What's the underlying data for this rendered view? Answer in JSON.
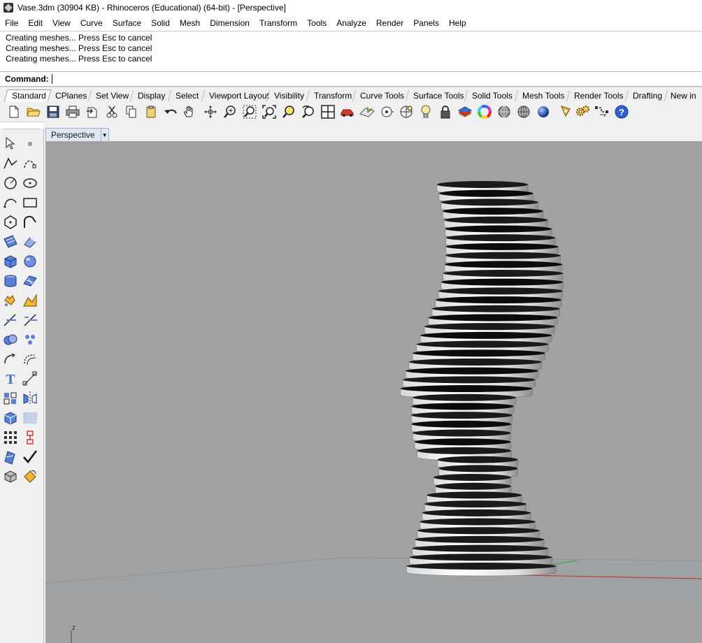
{
  "window": {
    "title": "Vase.3dm (30904 KB) - Rhinoceros (Educational) (64-bit) - [Perspective]"
  },
  "menu": [
    "File",
    "Edit",
    "View",
    "Curve",
    "Surface",
    "Solid",
    "Mesh",
    "Dimension",
    "Transform",
    "Tools",
    "Analyze",
    "Render",
    "Panels",
    "Help"
  ],
  "history": [
    "Creating meshes... Press Esc to cancel",
    "Creating meshes... Press Esc to cancel",
    "Creating meshes... Press Esc to cancel"
  ],
  "command": {
    "prompt": "Command:",
    "value": ""
  },
  "toolbar_tabs": [
    "Standard",
    "CPlanes",
    "Set View",
    "Display",
    "Select",
    "Viewport Layout",
    "Visibility",
    "Transform",
    "Curve Tools",
    "Surface Tools",
    "Solid Tools",
    "Mesh Tools",
    "Render Tools",
    "Drafting",
    "New in V"
  ],
  "active_tab": "Standard",
  "standard_icons": [
    "new-file-icon",
    "open-folder-icon",
    "save-icon",
    "print-icon",
    "import-icon",
    "cut-icon",
    "copy-icon",
    "paste-icon",
    "undo-icon",
    "pan-hand-icon",
    "rotate-view-icon",
    "zoom-icon",
    "zoom-window-icon",
    "zoom-extents-icon",
    "zoom-selected-icon",
    "undo-view-icon",
    "four-viewports-icon",
    "car-named-views-icon",
    "cplane-icon",
    "object-snap-icon",
    "light-bulb-icon",
    "lock-icon",
    "layer-icon",
    "color-wheel-icon",
    "render-sphere-icon",
    "rendered-sphere-icon",
    "shaded-sphere-icon",
    "rendering-lamp-icon",
    "options-gear-icon",
    "grasshopper-icon",
    "help-icon"
  ],
  "left_icons": [
    [
      "select-arrow-icon",
      "point-icon"
    ],
    [
      "polyline-icon",
      "curve-icon"
    ],
    [
      "circle-icon",
      "ellipse-icon"
    ],
    [
      "arc-icon",
      "rectangle-icon"
    ],
    [
      "polygon-icon",
      "freeform-curve-icon"
    ],
    [
      "surface-corner-icon",
      "extrude-surface-icon"
    ],
    [
      "box-solid-icon",
      "sphere-solid-icon"
    ],
    [
      "cylinder-icon",
      "mesh-plane-icon"
    ],
    [
      "explode-icon",
      "boolean-split-icon"
    ],
    [
      "trim-icon",
      "split-icon"
    ],
    [
      "boolean-union-icon",
      "array-points-icon"
    ],
    [
      "fillet-curve-icon",
      "offset-curve-icon"
    ],
    [
      "text-icon",
      "dimension-icon"
    ],
    [
      "group-icon",
      "mirror-icon"
    ],
    [
      "block-icon",
      "dimension-linear-icon"
    ],
    [
      "array-grid-icon",
      "history-icon"
    ],
    [
      "analyze-icon",
      "check-icon"
    ],
    [
      "render-material-icon",
      "flow-icon"
    ]
  ],
  "viewport": {
    "label": "Perspective",
    "axis_label": "z"
  },
  "colors": {
    "viewport_bg": "#a2a2a2",
    "ground": "#9ea1a3",
    "x_axis": "#cc2a2a",
    "y_axis": "#2fa82f"
  },
  "model": {
    "description_note": "",
    "slice_count": 44
  }
}
